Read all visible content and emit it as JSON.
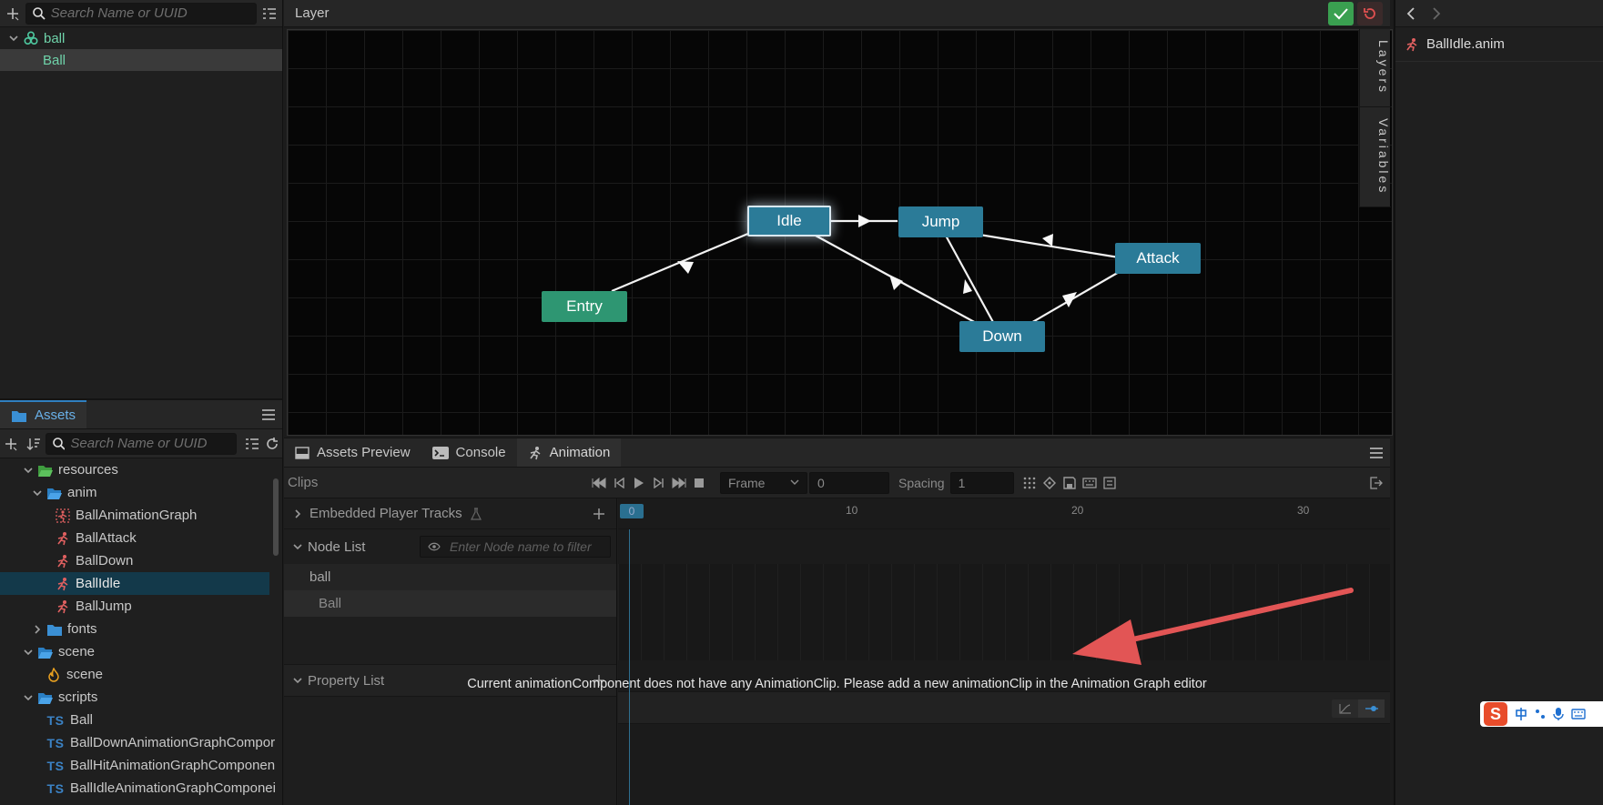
{
  "hierarchy": {
    "search_placeholder": "Search Name or UUID",
    "root_node": "ball",
    "child_node": "Ball"
  },
  "assets": {
    "tab_label": "Assets",
    "search_placeholder": "Search Name or UUID",
    "items": [
      {
        "label": "resources",
        "kind": "folder-open",
        "expanded": true
      },
      {
        "label": "anim",
        "kind": "folder-open",
        "expanded": true
      },
      {
        "label": "BallAnimationGraph",
        "kind": "anim-graph"
      },
      {
        "label": "BallAttack",
        "kind": "anim-clip"
      },
      {
        "label": "BallDown",
        "kind": "anim-clip"
      },
      {
        "label": "BallIdle",
        "kind": "anim-clip",
        "selected": true
      },
      {
        "label": "BallJump",
        "kind": "anim-clip"
      },
      {
        "label": "fonts",
        "kind": "folder",
        "expanded": false
      },
      {
        "label": "scene",
        "kind": "folder-open",
        "expanded": true
      },
      {
        "label": "scene",
        "kind": "scene-file"
      },
      {
        "label": "scripts",
        "kind": "folder-open",
        "expanded": true
      },
      {
        "label": "Ball",
        "kind": "ts"
      },
      {
        "label": "BallDownAnimationGraphCompor",
        "kind": "ts"
      },
      {
        "label": "BallHitAnimationGraphComponen",
        "kind": "ts"
      },
      {
        "label": "BallIdleAnimationGraphComponei",
        "kind": "ts"
      }
    ]
  },
  "layer": {
    "title": "Layer",
    "side_tabs": [
      "Layers",
      "Variables"
    ],
    "states": {
      "idle": "Idle",
      "jump": "Jump",
      "attack": "Attack",
      "entry": "Entry",
      "down": "Down"
    }
  },
  "bottom": {
    "tabs": [
      "Assets Preview",
      "Console",
      "Animation"
    ],
    "clips_label": "Clips",
    "frame_select": "Frame",
    "frame_value": "0",
    "spacing_label": "Spacing",
    "spacing_value": "1",
    "embedded_tracks": "Embedded Player Tracks",
    "node_list": "Node List",
    "node_filter_placeholder": "Enter Node name to filter",
    "nodes": [
      "ball",
      "Ball"
    ],
    "property_list": "Property List",
    "timeline_ticks": [
      "0",
      "10",
      "20",
      "30"
    ],
    "message": "Current animationComponent does not have any AnimationClip. Please add a new animationClip in the Animation Graph editor"
  },
  "inspector": {
    "file_name": "BallIdle.anim"
  },
  "colors": {
    "state_blue": "#2b7b98",
    "state_green": "#2e9672",
    "accent": "#69b0e8",
    "arrow": "#e25555"
  }
}
